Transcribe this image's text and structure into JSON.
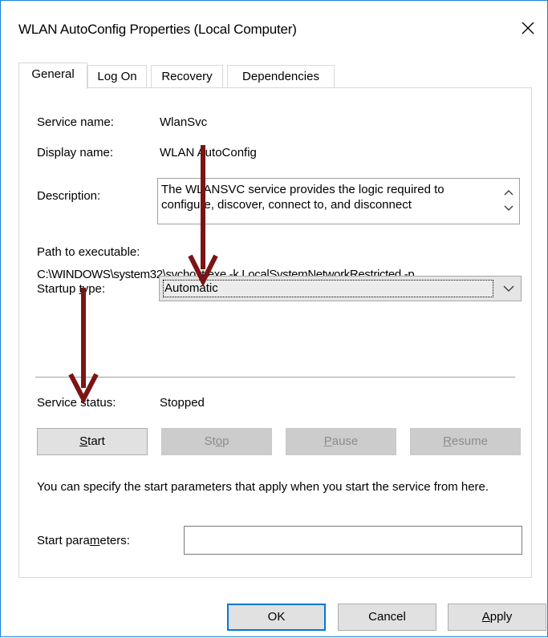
{
  "window": {
    "title": "WLAN AutoConfig Properties (Local Computer)"
  },
  "tabs": [
    {
      "label": "General",
      "active": true
    },
    {
      "label": "Log On",
      "active": false
    },
    {
      "label": "Recovery",
      "active": false
    },
    {
      "label": "Dependencies",
      "active": false
    }
  ],
  "general": {
    "service_name_label": "Service name:",
    "service_name_value": "WlanSvc",
    "display_name_label": "Display name:",
    "display_name_value": "WLAN AutoConfig",
    "description_label": "Description:",
    "description_value": "The WLANSVC service provides the logic required to configure, discover, connect to, and disconnect",
    "path_label": "Path to executable:",
    "path_value": "C:\\WINDOWS\\system32\\svchost.exe -k LocalSystemNetworkRestricted -p",
    "startup_label_pre": "Startup ",
    "startup_label_u": "t",
    "startup_label_post": "ype:",
    "startup_value": "Automatic",
    "status_label": "Service status:",
    "status_value": "Stopped",
    "buttons": {
      "start": {
        "u": "S",
        "rest": "tart"
      },
      "stop": {
        "pre": "St",
        "u": "o",
        "post": "p"
      },
      "pause": {
        "u": "P",
        "rest": "ause"
      },
      "resume": {
        "u": "R",
        "rest": "esume"
      }
    },
    "hint": "You can specify the start parameters that apply when you start the service from here.",
    "params_label_pre": "Start para",
    "params_label_u": "m",
    "params_label_post": "eters:",
    "params_value": ""
  },
  "footer": {
    "ok": "OK",
    "cancel": "Cancel",
    "apply_u": "A",
    "apply_rest": "pply"
  },
  "colors": {
    "accent": "#0078d7",
    "arrow": "#7b1515"
  },
  "icons": [
    "close-icon",
    "scroll-up-icon",
    "scroll-down-icon",
    "chevron-down-icon",
    "annotation-arrow"
  ]
}
